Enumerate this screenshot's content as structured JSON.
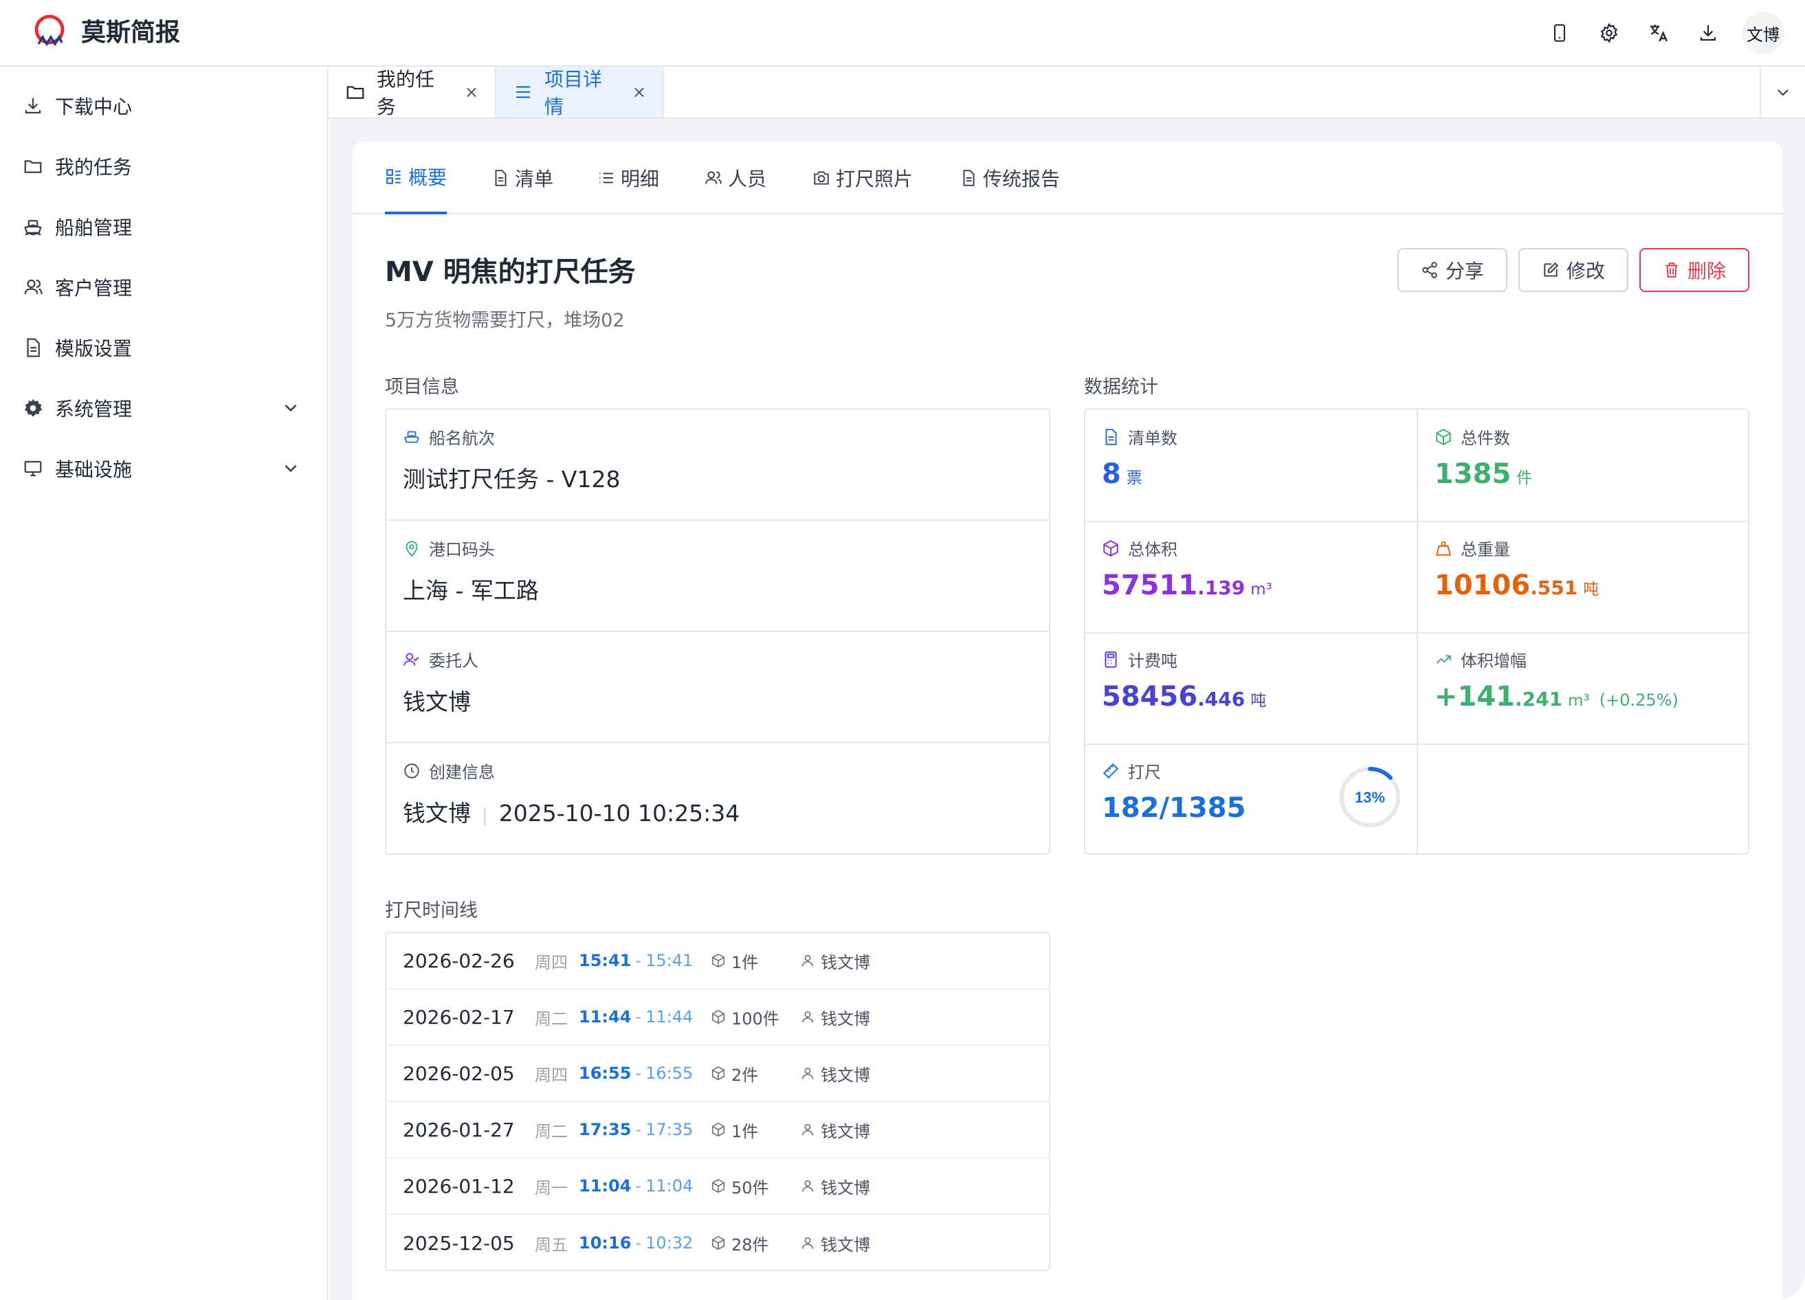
{
  "app": {
    "brand": "莫斯简报",
    "avatar_label": "文博"
  },
  "header": {
    "icons": [
      "tablet-icon",
      "gear-icon",
      "translate-icon",
      "download-icon"
    ]
  },
  "sidebar": {
    "items": [
      {
        "label": "下载中心",
        "icon": "download-icon"
      },
      {
        "label": "我的任务",
        "icon": "folder-icon"
      },
      {
        "label": "船舶管理",
        "icon": "ship-icon"
      },
      {
        "label": "客户管理",
        "icon": "users-icon"
      },
      {
        "label": "模版设置",
        "icon": "document-icon"
      },
      {
        "label": "系统管理",
        "icon": "gear-icon",
        "expandable": true
      },
      {
        "label": "基础设施",
        "icon": "monitor-icon",
        "expandable": true
      }
    ]
  },
  "tabs": [
    {
      "label": "我的任务",
      "close": "×",
      "active": false
    },
    {
      "label": "项目详情",
      "close": "×",
      "active": true
    }
  ],
  "subtabs": [
    "概要",
    "清单",
    "明细",
    "人员",
    "打尺照片",
    "传统报告"
  ],
  "project": {
    "title": "MV 明焦的打尺任务",
    "description": "5万方货物需要打尺，堆场02",
    "actions": {
      "share": "分享",
      "edit": "修改",
      "delete": "删除"
    }
  },
  "info": {
    "section_label": "项目信息",
    "rows": [
      {
        "label": "船名航次",
        "value": "测试打尺任务 - V128"
      },
      {
        "label": "港口码头",
        "value": "上海 - 军工路"
      },
      {
        "label": "委托人",
        "value": "钱文博"
      },
      {
        "label": "创建信息",
        "value": "钱文博",
        "separator": "|",
        "value2": "2025-10-10 10:25:34"
      }
    ]
  },
  "stats": {
    "section_label": "数据统计",
    "colors": {
      "blue": "#2b62d9",
      "green": "#3fae6f",
      "purple": "#8b32d8",
      "orange": "#e2630f",
      "indigo": "#4a43d0",
      "bright_blue": "#1d6fd8"
    },
    "items": [
      {
        "label": "清单数",
        "int": "8",
        "dec": "",
        "unit": "票"
      },
      {
        "label": "总件数",
        "int": "1385",
        "dec": "",
        "unit": "件"
      },
      {
        "label": "总体积",
        "int": "57511",
        "dec": ".139",
        "unit": "m³"
      },
      {
        "label": "总重量",
        "int": "10106",
        "dec": ".551",
        "unit": "吨"
      },
      {
        "label": "计费吨",
        "int": "58456",
        "dec": ".446",
        "unit": "吨"
      },
      {
        "label": "体积增幅",
        "int": "+141",
        "dec": ".241",
        "unit": "m³",
        "extra": "(+0.25%)"
      },
      {
        "label": "打尺",
        "int": "182/1385",
        "dec": "",
        "unit": "",
        "progress_label": "13%",
        "progress": 0.13
      }
    ]
  },
  "timeline": {
    "section_label": "打尺时间线",
    "rows": [
      {
        "date": "2026-02-26",
        "weekday": "周四",
        "start": "15:41",
        "dash": "-",
        "end": "15:41",
        "qty": "1件",
        "user": "钱文博"
      },
      {
        "date": "2026-02-17",
        "weekday": "周二",
        "start": "11:44",
        "dash": "-",
        "end": "11:44",
        "qty": "100件",
        "user": "钱文博"
      },
      {
        "date": "2026-02-05",
        "weekday": "周四",
        "start": "16:55",
        "dash": "-",
        "end": "16:55",
        "qty": "2件",
        "user": "钱文博"
      },
      {
        "date": "2026-01-27",
        "weekday": "周二",
        "start": "17:35",
        "dash": "-",
        "end": "17:35",
        "qty": "1件",
        "user": "钱文博"
      },
      {
        "date": "2026-01-12",
        "weekday": "周一",
        "start": "11:04",
        "dash": "-",
        "end": "11:04",
        "qty": "50件",
        "user": "钱文博"
      },
      {
        "date": "2025-12-05",
        "weekday": "周五",
        "start": "10:16",
        "dash": "-",
        "end": "10:32",
        "qty": "28件",
        "user": "钱文博"
      }
    ]
  }
}
